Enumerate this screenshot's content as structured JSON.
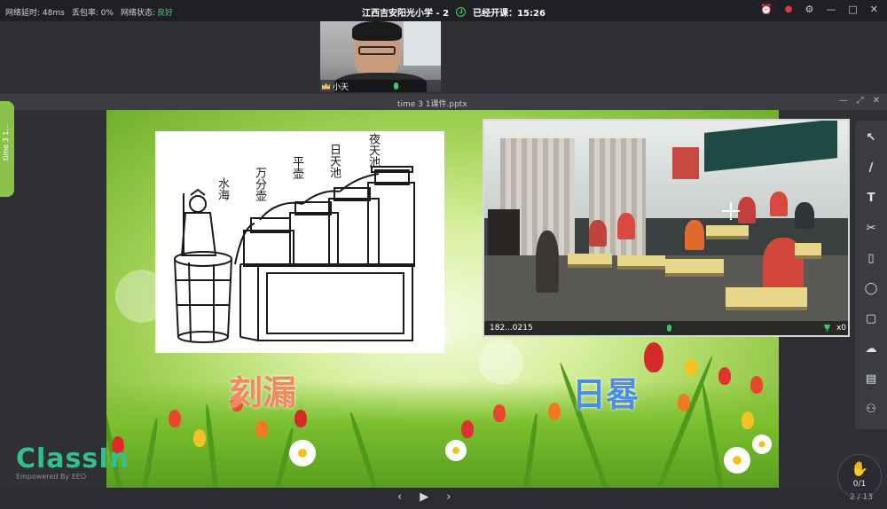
{
  "status_bar": {
    "latency": "网络延时: 48ms",
    "packet_loss": "丢包率: 0%",
    "net_status_label": "网络状态:",
    "net_status_value": "良好",
    "title": "江西吉安阳光小学 - 2",
    "class_status": "已经开课：15:26",
    "colors": {
      "good": "#4fc27a",
      "record": "#e0393e"
    }
  },
  "teacher_video": {
    "name": "小天"
  },
  "doc_window": {
    "filename": "time 3 1课件.pptx"
  },
  "side_tab": {
    "label": "time 3 1..."
  },
  "slide": {
    "drawing_labels": {
      "water_sea": "水海",
      "wanfen_hu": "万分壶",
      "ping_hu": "平壶",
      "ritian_chi": "日天池",
      "yetian_chi": "夜天池"
    },
    "label_left": "刻漏",
    "label_right": "日晷"
  },
  "classroom_video": {
    "device_id": "182...0215",
    "count": "x0"
  },
  "toolbar": {
    "items": [
      {
        "icon": "cursor-icon",
        "glyph": "↖"
      },
      {
        "icon": "pen-icon",
        "glyph": "/"
      },
      {
        "icon": "text-icon",
        "glyph": "T"
      },
      {
        "icon": "scissors-icon",
        "glyph": "✂"
      },
      {
        "icon": "trash-icon",
        "glyph": "▯"
      },
      {
        "icon": "shape-icon",
        "glyph": "◯"
      },
      {
        "icon": "chat-icon",
        "glyph": "▢"
      },
      {
        "icon": "cloud-icon",
        "glyph": "☁"
      },
      {
        "icon": "toolbox-icon",
        "glyph": "▤"
      },
      {
        "icon": "users-icon",
        "glyph": "⚇"
      }
    ]
  },
  "pager": {
    "prev": "‹",
    "play": "▶",
    "next": "›",
    "page": "2 / 13"
  },
  "logo": {
    "main": "ClassIn",
    "sub": "Empowered By EEO"
  },
  "hand_raise": {
    "count": "0/1"
  }
}
